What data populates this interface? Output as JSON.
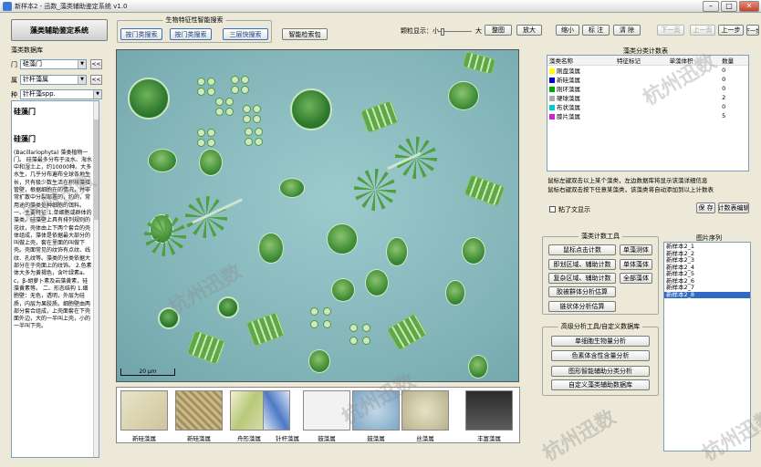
{
  "window": {
    "title": "新样本2 - 迅数_藻类辅助鉴定系统 v1.0",
    "min": "–",
    "max": "□",
    "close": "✕"
  },
  "left": {
    "system_button": "藻类辅助鉴定系统",
    "db_label": "藻类数据库",
    "phylum_label": "门",
    "phylum_value": "硅藻门",
    "class_label": "属",
    "class_value": "针杆藻属",
    "species_label": "种",
    "species_value": "针杆藻spp.",
    "small_btn": "<<",
    "text_title": "硅藻门",
    "text_heading": "硅藻门",
    "text_body": "(Bacillariophyta) 藻类植物一门。    硅藻最多分布于淡水、海水中和湿土上，约10000种。大多水生，几乎分布遍布全球各地生长，只有极少数生活在积核藻接管壁，根据细胞在的情况，并非常扩散中分裂部署的，约的，常用途的藻类处种细胞的饵料。    一、主要特征    1.单细胞或群体的藻类。硅藻壁上具有排列规则的花纹，壳体由上下两个套合的壳体组成，藻体是依据最大部分的叫做上壳，套在里面的叫做下壳。壳面常见的纹饰有点纹、线纹、孔纹等。藻类的分类依据大部分在于壳面上的纹饰。    2.色素体大多为黄褐色，含叶绿素a、c，β-胡萝卜素及岩藻黄素，硅藻黄素等。    二、形态结构    1.细胞壁：无色，透明，外层为硅质，内层为果胶质。细胞壁由两部分套合组成，上壳面套在下壳面外边，大的一半叫上壳，小的一半叫下壳。"
  },
  "toolbar": {
    "group_label": "生物特征性智能搜索",
    "search1": "按门类搜索",
    "search2": "按门类搜索",
    "search3": "三层快搜索",
    "smart_pack": "智能检索包",
    "zoom_label": "颗粒显示：小",
    "zoom_big": "大",
    "full": "整图",
    "enlarge": "放大",
    "shrink": "缩小",
    "mark": "标 注",
    "clear": "清 除",
    "next_page": "下一页",
    "prev_page": "上一页",
    "step_prev": "上一步",
    "step_next": "下一步"
  },
  "scene": {
    "scale_label": "20 μm"
  },
  "thumbnails": [
    {
      "label": "新硅藻属"
    },
    {
      "label": "新硅藻属"
    },
    {
      "label": "舟形藻属"
    },
    {
      "label": "针杆藻属"
    },
    {
      "label": "鼓藻属"
    },
    {
      "label": "鼓藻属"
    },
    {
      "label": "丝藻属"
    },
    {
      "label": "丰富藻属"
    }
  ],
  "stats": {
    "title": "藻类分类计数表",
    "headers": [
      "藻类名称",
      "特征标记",
      "单藻体积",
      "数量"
    ],
    "rows": [
      {
        "name": "刚盘藻属",
        "color": "#ffff00",
        "count": "0"
      },
      {
        "name": "新硅藻属",
        "color": "#0000cc",
        "count": "0"
      },
      {
        "name": "刚环藻属",
        "color": "#00aa00",
        "count": "0"
      },
      {
        "name": "硬球藻属",
        "color": "#aaaaaa",
        "count": "2"
      },
      {
        "name": "布状藻属",
        "color": "#00cccc",
        "count": "0"
      },
      {
        "name": "膝片藻属",
        "color": "#cc22cc",
        "count": "5"
      }
    ],
    "hint1": "鼠标左键双击以上某个藻类，左边数据库将显示该藻详细信息",
    "hint2": "鼠标右键双击按下任意某藻类，该藻类将自动添加到以上计数表",
    "checkbox_label": "粘了文显示",
    "save": "保 存",
    "stat_table": "计数表编辑"
  },
  "counter": {
    "title": "藻类计数工具",
    "b1": "鼠标点击计数",
    "b2": "单藻测体",
    "b3": "即划区域、辅助计数",
    "b4": "单体藻体",
    "b5": "复杂区域、辅助计数",
    "b6": "全部藻体",
    "b7": "胶被群体分析估算",
    "b8": "链状体分析估算"
  },
  "advanced": {
    "title": "高级分析工具/自定义数据库",
    "b1": "单细胞生物量分析",
    "b2": "色素体含性含量分析",
    "b3": "图形智能辅助分类分析",
    "b4": "自定义藻类辅助数据库"
  },
  "images": {
    "title": "图片序列",
    "items": [
      "新样本2_1",
      "新样本2_2",
      "新样本2_3",
      "新样本2_4",
      "新样本2_5",
      "新样本2_6",
      "新样本2_7",
      "新样本2_8"
    ],
    "selected_index": 7
  },
  "watermark": "杭州迅数"
}
